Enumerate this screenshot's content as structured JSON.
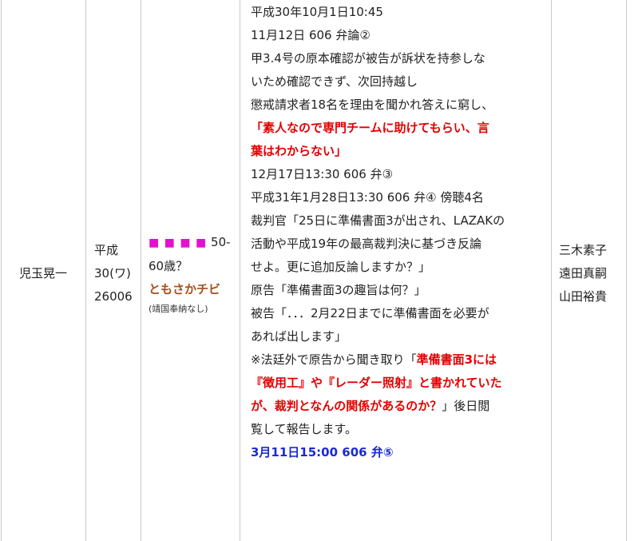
{
  "row": {
    "defendant": "児玉晃一",
    "case_era": "平成",
    "case_year_type": "30(ワ)",
    "case_number": "26006",
    "judge": {
      "stars": "■ ■ ■ ■",
      "age_inline": "50-",
      "age_rest": "60歳？",
      "name": "ともさかチビ",
      "note": "(靖国奉納なし)"
    },
    "notes": {
      "l1": "平成30年10月1日10:45",
      "l2": "11月12日 606 弁論②",
      "l3": "甲3.4号の原本確認が被告が訴状を持参しな",
      "l4": "いため確認できず、次回持越し",
      "l5": "懲戒請求者18名を理由を聞かれ答えに窮し、",
      "l6": "「素人なので専門チームに助けてもらい、言",
      "l7": "葉はわからない」",
      "l8": "12月17日13:30 606 弁③",
      "l9": "平成31年1月28日13:30 606 弁④ 傍聴4名",
      "l10": "裁判官「25日に準備書面3が出され、LAZAKの",
      "l11": "活動や平成19年の最高裁判決に基づき反論",
      "l12": "せよ。更に追加反論しますか？」",
      "l13": "原告「準備書面3の趣旨は何？」",
      "l14": "被告「．．．2月22日までに準備書面を必要が",
      "l15": "あれば出します」",
      "l16a": "※法廷外で原告から聞き取り「",
      "l16b": "準備書面3には",
      "l17": "『徴用工』や『レーダー照射』と書かれていた",
      "l18a": "が、裁判となんの関係があるのか？",
      "l18b": "」後日閲",
      "l19": "覧して報告します。",
      "l20": "3月11日15:00 606 弁⑤"
    },
    "judges_panel": [
      "三木素子",
      "遠田真嗣",
      "山田裕貴"
    ]
  },
  "colors": {
    "highlight_red": "#e30000",
    "highlight_blue": "#1a2ad6",
    "stars_pink": "#e60fd0",
    "judge_brown": "#a5501b"
  }
}
